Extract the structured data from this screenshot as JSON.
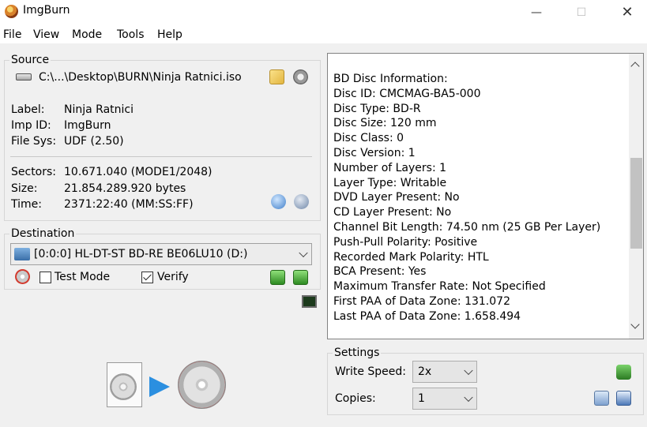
{
  "window": {
    "title": "ImgBurn",
    "min": "—",
    "max": "☐",
    "close": "✕"
  },
  "menu": [
    "File",
    "View",
    "Mode",
    "Tools",
    "Help"
  ],
  "source": {
    "group_label": "Source",
    "path": "C:\\...\\Desktop\\BURN\\Ninja Ratnici.iso",
    "label_key": "Label:",
    "label_value": "Ninja Ratnici",
    "impid_key": "Imp ID:",
    "impid_value": "ImgBurn",
    "filesys_key": "File Sys:",
    "filesys_value": "UDF (2.50)",
    "sectors_key": "Sectors:",
    "sectors_value": "10.671.040 (MODE1/2048)",
    "size_key": "Size:",
    "size_value": "21.854.289.920 bytes",
    "time_key": "Time:",
    "time_value": "2371:22:40 (MM:SS:FF)"
  },
  "destination": {
    "group_label": "Destination",
    "drive": "[0:0:0] HL-DT-ST BD-RE  BE06LU10 (D:)",
    "test_mode": "Test Mode",
    "verify": "Verify"
  },
  "info": {
    "lines": [
      "BD Disc Information:",
      "Disc ID: CMCMAG-BA5-000",
      "Disc Type: BD-R",
      "Disc Size: 120 mm",
      "Disc Class: 0",
      "Disc Version: 1",
      "Number of Layers: 1",
      "Layer Type: Writable",
      "DVD Layer Present: No",
      "CD Layer Present: No",
      "Channel Bit Length: 74.50 nm (25 GB Per Layer)",
      "Push-Pull Polarity: Positive",
      "Recorded Mark Polarity: HTL",
      "BCA Present: Yes",
      "Maximum Transfer Rate: Not Specified",
      "First PAA of Data Zone: 131.072",
      "Last PAA of Data Zone: 1.658.494"
    ]
  },
  "settings": {
    "group_label": "Settings",
    "write_speed_label": "Write Speed:",
    "write_speed_value": "2x",
    "copies_label": "Copies:",
    "copies_value": "1"
  }
}
